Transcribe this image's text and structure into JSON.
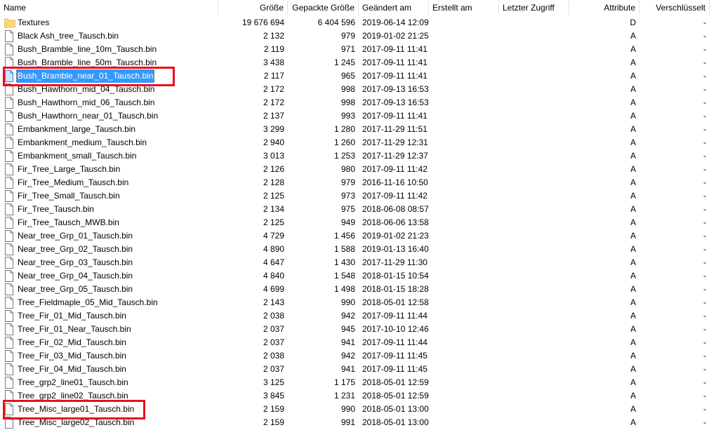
{
  "columns": {
    "name": "Name",
    "size": "Größe",
    "packed": "Gepackte Größe",
    "modified": "Geändert am",
    "created": "Erstellt am",
    "accessed": "Letzter Zugriff",
    "attributes": "Attribute",
    "encrypted": "Verschlüsselt"
  },
  "rows": [
    {
      "type": "folder",
      "name": "Textures",
      "size": "19 676 694",
      "packed": "6 404 596",
      "modified": "2019-06-14 12:09",
      "created": "",
      "accessed": "",
      "attributes": "D",
      "encrypted": "-"
    },
    {
      "type": "file",
      "name": "Black Ash_tree_Tausch.bin",
      "size": "2 132",
      "packed": "979",
      "modified": "2019-01-02 21:25",
      "created": "",
      "accessed": "",
      "attributes": "A",
      "encrypted": "-"
    },
    {
      "type": "file",
      "name": "Bush_Bramble_line_10m_Tausch.bin",
      "size": "2 119",
      "packed": "971",
      "modified": "2017-09-11 11:41",
      "created": "",
      "accessed": "",
      "attributes": "A",
      "encrypted": "-"
    },
    {
      "type": "file",
      "name": "Bush_Bramble_line_50m_Tausch.bin",
      "size": "3 438",
      "packed": "1 245",
      "modified": "2017-09-11 11:41",
      "created": "",
      "accessed": "",
      "attributes": "A",
      "encrypted": "-"
    },
    {
      "type": "file",
      "name": "Bush_Bramble_near_01_Tausch.bin",
      "size": "2 117",
      "packed": "965",
      "modified": "2017-09-11 11:41",
      "created": "",
      "accessed": "",
      "attributes": "A",
      "encrypted": "-",
      "selected": true
    },
    {
      "type": "file",
      "name": "Bush_Hawthorn_mid_04_Tausch.bin",
      "size": "2 172",
      "packed": "998",
      "modified": "2017-09-13 16:53",
      "created": "",
      "accessed": "",
      "attributes": "A",
      "encrypted": "-"
    },
    {
      "type": "file",
      "name": "Bush_Hawthorn_mid_06_Tausch.bin",
      "size": "2 172",
      "packed": "998",
      "modified": "2017-09-13 16:53",
      "created": "",
      "accessed": "",
      "attributes": "A",
      "encrypted": "-"
    },
    {
      "type": "file",
      "name": "Bush_Hawthorn_near_01_Tausch.bin",
      "size": "2 137",
      "packed": "993",
      "modified": "2017-09-11 11:41",
      "created": "",
      "accessed": "",
      "attributes": "A",
      "encrypted": "-"
    },
    {
      "type": "file",
      "name": "Embankment_large_Tausch.bin",
      "size": "3 299",
      "packed": "1 280",
      "modified": "2017-11-29 11:51",
      "created": "",
      "accessed": "",
      "attributes": "A",
      "encrypted": "-"
    },
    {
      "type": "file",
      "name": "Embankment_medium_Tausch.bin",
      "size": "2 940",
      "packed": "1 260",
      "modified": "2017-11-29 12:31",
      "created": "",
      "accessed": "",
      "attributes": "A",
      "encrypted": "-"
    },
    {
      "type": "file",
      "name": "Embankment_small_Tausch.bin",
      "size": "3 013",
      "packed": "1 253",
      "modified": "2017-11-29 12:37",
      "created": "",
      "accessed": "",
      "attributes": "A",
      "encrypted": "-"
    },
    {
      "type": "file",
      "name": "Fir_Tree_Large_Tausch.bin",
      "size": "2 126",
      "packed": "980",
      "modified": "2017-09-11 11:42",
      "created": "",
      "accessed": "",
      "attributes": "A",
      "encrypted": "-"
    },
    {
      "type": "file",
      "name": "Fir_Tree_Medium_Tausch.bin",
      "size": "2 128",
      "packed": "979",
      "modified": "2016-11-16 10:50",
      "created": "",
      "accessed": "",
      "attributes": "A",
      "encrypted": "-"
    },
    {
      "type": "file",
      "name": "Fir_Tree_Small_Tausch.bin",
      "size": "2 125",
      "packed": "973",
      "modified": "2017-09-11 11:42",
      "created": "",
      "accessed": "",
      "attributes": "A",
      "encrypted": "-"
    },
    {
      "type": "file",
      "name": "Fir_Tree_Tausch.bin",
      "size": "2 134",
      "packed": "975",
      "modified": "2018-06-08 08:57",
      "created": "",
      "accessed": "",
      "attributes": "A",
      "encrypted": "-"
    },
    {
      "type": "file",
      "name": "Fir_Tree_Tausch_MWB.bin",
      "size": "2 125",
      "packed": "949",
      "modified": "2018-06-06 13:58",
      "created": "",
      "accessed": "",
      "attributes": "A",
      "encrypted": "-"
    },
    {
      "type": "file",
      "name": "Near_tree_Grp_01_Tausch.bin",
      "size": "4 729",
      "packed": "1 456",
      "modified": "2019-01-02 21:23",
      "created": "",
      "accessed": "",
      "attributes": "A",
      "encrypted": "-"
    },
    {
      "type": "file",
      "name": "Near_tree_Grp_02_Tausch.bin",
      "size": "4 890",
      "packed": "1 588",
      "modified": "2019-01-13 16:40",
      "created": "",
      "accessed": "",
      "attributes": "A",
      "encrypted": "-"
    },
    {
      "type": "file",
      "name": "Near_tree_Grp_03_Tausch.bin",
      "size": "4 647",
      "packed": "1 430",
      "modified": "2017-11-29 11:30",
      "created": "",
      "accessed": "",
      "attributes": "A",
      "encrypted": "-"
    },
    {
      "type": "file",
      "name": "Near_tree_Grp_04_Tausch.bin",
      "size": "4 840",
      "packed": "1 548",
      "modified": "2018-01-15 10:54",
      "created": "",
      "accessed": "",
      "attributes": "A",
      "encrypted": "-"
    },
    {
      "type": "file",
      "name": "Near_tree_Grp_05_Tausch.bin",
      "size": "4 699",
      "packed": "1 498",
      "modified": "2018-01-15 18:28",
      "created": "",
      "accessed": "",
      "attributes": "A",
      "encrypted": "-"
    },
    {
      "type": "file",
      "name": "Tree_Fieldmaple_05_Mid_Tausch.bin",
      "size": "2 143",
      "packed": "990",
      "modified": "2018-05-01 12:58",
      "created": "",
      "accessed": "",
      "attributes": "A",
      "encrypted": "-"
    },
    {
      "type": "file",
      "name": "Tree_Fir_01_Mid_Tausch.bin",
      "size": "2 038",
      "packed": "942",
      "modified": "2017-09-11 11:44",
      "created": "",
      "accessed": "",
      "attributes": "A",
      "encrypted": "-"
    },
    {
      "type": "file",
      "name": "Tree_Fir_01_Near_Tausch.bin",
      "size": "2 037",
      "packed": "945",
      "modified": "2017-10-10 12:46",
      "created": "",
      "accessed": "",
      "attributes": "A",
      "encrypted": "-"
    },
    {
      "type": "file",
      "name": "Tree_Fir_02_Mid_Tausch.bin",
      "size": "2 037",
      "packed": "941",
      "modified": "2017-09-11 11:44",
      "created": "",
      "accessed": "",
      "attributes": "A",
      "encrypted": "-"
    },
    {
      "type": "file",
      "name": "Tree_Fir_03_Mid_Tausch.bin",
      "size": "2 038",
      "packed": "942",
      "modified": "2017-09-11 11:45",
      "created": "",
      "accessed": "",
      "attributes": "A",
      "encrypted": "-"
    },
    {
      "type": "file",
      "name": "Tree_Fir_04_Mid_Tausch.bin",
      "size": "2 037",
      "packed": "941",
      "modified": "2017-09-11 11:45",
      "created": "",
      "accessed": "",
      "attributes": "A",
      "encrypted": "-"
    },
    {
      "type": "file",
      "name": "Tree_grp2_line01_Tausch.bin",
      "size": "3 125",
      "packed": "1 175",
      "modified": "2018-05-01 12:59",
      "created": "",
      "accessed": "",
      "attributes": "A",
      "encrypted": "-"
    },
    {
      "type": "file",
      "name": "Tree_grp2_line02_Tausch.bin",
      "size": "3 845",
      "packed": "1 231",
      "modified": "2018-05-01 12:59",
      "created": "",
      "accessed": "",
      "attributes": "A",
      "encrypted": "-"
    },
    {
      "type": "file",
      "name": "Tree_Misc_large01_Tausch.bin",
      "size": "2 159",
      "packed": "990",
      "modified": "2018-05-01 13:00",
      "created": "",
      "accessed": "",
      "attributes": "A",
      "encrypted": "-"
    },
    {
      "type": "file",
      "name": "Tree_Misc_large02_Tausch.bin",
      "size": "2 159",
      "packed": "991",
      "modified": "2018-05-01 13:00",
      "created": "",
      "accessed": "",
      "attributes": "A",
      "encrypted": "-"
    }
  ],
  "colors": {
    "selection": "#3399ff",
    "highlight_box": "#e8101f",
    "folder": "#f8d775"
  },
  "highlighted_rows": [
    4,
    29
  ]
}
